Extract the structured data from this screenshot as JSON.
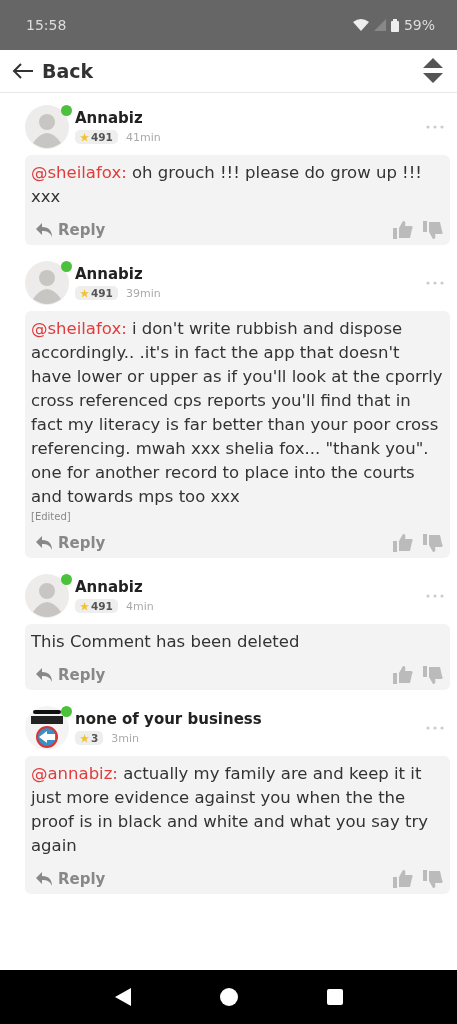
{
  "status_bar": {
    "time": "15:58",
    "battery": "59%"
  },
  "header": {
    "back_label": "Back"
  },
  "comments": [
    {
      "author": "Annabiz",
      "online": true,
      "avatar": {
        "kind": "default"
      },
      "score": "491",
      "time": "41min",
      "mention": "@sheilafox:",
      "body": "oh grouch !!! please do grow up !!! xxx",
      "edited": false,
      "reply_label": "Reply"
    },
    {
      "author": "Annabiz",
      "online": true,
      "avatar": {
        "kind": "default"
      },
      "score": "491",
      "time": "39min",
      "mention": "@sheilafox:",
      "body": "i don't write rubbish and dispose accordingly.. .it's in fact the app that doesn't have lower or upper as if you'll look at the cporrly cross referenced cps reports you'll find that in fact my literacy is far better than your poor cross referencing. mwah xxx shelia fox... \"thank you\". one for another record to place into the courts and towards mps too xxx",
      "edited": true,
      "edited_label": "[Edited]",
      "reply_label": "Reply"
    },
    {
      "author": "Annabiz",
      "online": true,
      "avatar": {
        "kind": "default"
      },
      "score": "491",
      "time": "4min",
      "body": "This Comment has been deleted",
      "edited": false,
      "reply_label": "Reply"
    },
    {
      "author": "none of your business",
      "online": true,
      "score": "3",
      "time": "3min",
      "mention": "@annabiz:",
      "body": "actually my family are and keep it it just more evidence against you when the the proof is in black and white and what you say try again",
      "edited": false,
      "reply_label": "Reply"
    }
  ]
}
